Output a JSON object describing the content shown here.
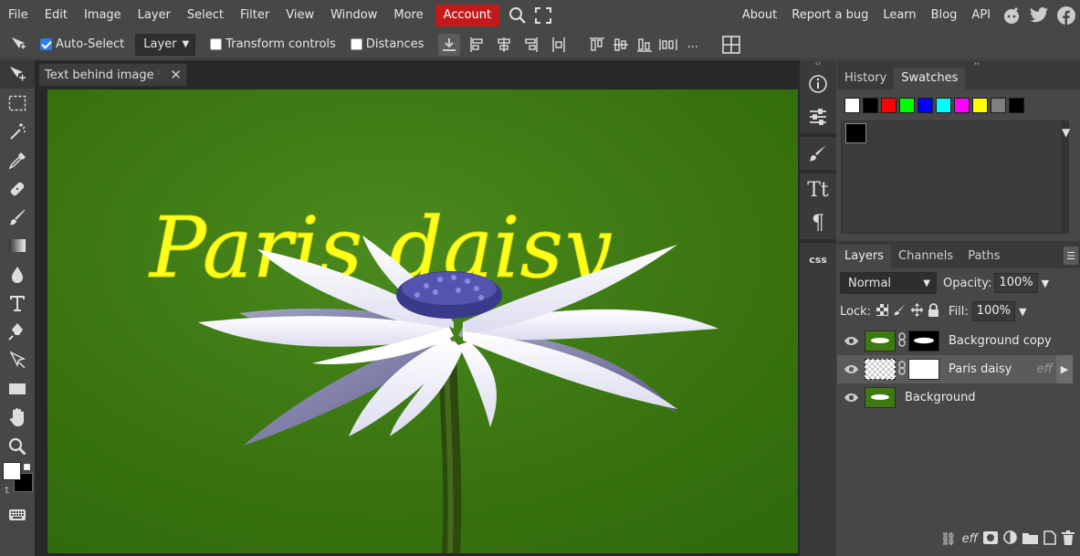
{
  "menubar": {
    "items": [
      "File",
      "Edit",
      "Image",
      "Layer",
      "Select",
      "Filter",
      "View",
      "Window",
      "More"
    ],
    "account": "Account",
    "right_links": [
      "About",
      "Report a bug",
      "Learn",
      "Blog",
      "API"
    ],
    "social": [
      "reddit-icon",
      "twitter-icon",
      "facebook-icon"
    ]
  },
  "options": {
    "auto_select_label": "Auto-Select",
    "auto_select_checked": true,
    "layer_select_value": "Layer",
    "transform_controls_label": "Transform controls",
    "distances_label": "Distances",
    "more_label": "..."
  },
  "tools": [
    "move-tool-icon",
    "marquee-tool-icon",
    "magic-wand-icon",
    "eyedropper-icon",
    "healing-brush-icon",
    "brush-icon",
    "gradient-icon",
    "blur-icon",
    "type-tool-icon",
    "pen-tool-icon",
    "path-select-icon",
    "rectangle-tool-icon",
    "hand-tool-icon",
    "zoom-tool-icon"
  ],
  "document": {
    "tab_title": "Text behind image *",
    "canvas_text": "Paris daisy"
  },
  "side_strip": {
    "css_label": "css"
  },
  "swatches_panel": {
    "tabs": [
      "History",
      "Swatches"
    ],
    "active_tab": "Swatches",
    "colors": [
      "#ffffff",
      "#000000",
      "#ff0000",
      "#00ff00",
      "#0000ff",
      "#00ffff",
      "#ff00ff",
      "#ffff00",
      "#808080",
      "#000000"
    ],
    "current": "#000000"
  },
  "layers_panel": {
    "tabs": [
      "Layers",
      "Channels",
      "Paths"
    ],
    "active_tab": "Layers",
    "blend_mode": "Normal",
    "opacity_label": "Opacity:",
    "opacity_value": "100%",
    "lock_label": "Lock:",
    "fill_label": "Fill:",
    "fill_value": "100%",
    "layers": [
      {
        "name": "Background copy",
        "selected": false
      },
      {
        "name": "Paris daisy",
        "selected": true,
        "fx": "eff"
      },
      {
        "name": "Background",
        "selected": false
      }
    ],
    "footer_eff": "eff"
  },
  "colors": {
    "account_red": "#c21a1a",
    "canvas_green": "#3d7a12",
    "text_yellow": "#ffff1a"
  }
}
